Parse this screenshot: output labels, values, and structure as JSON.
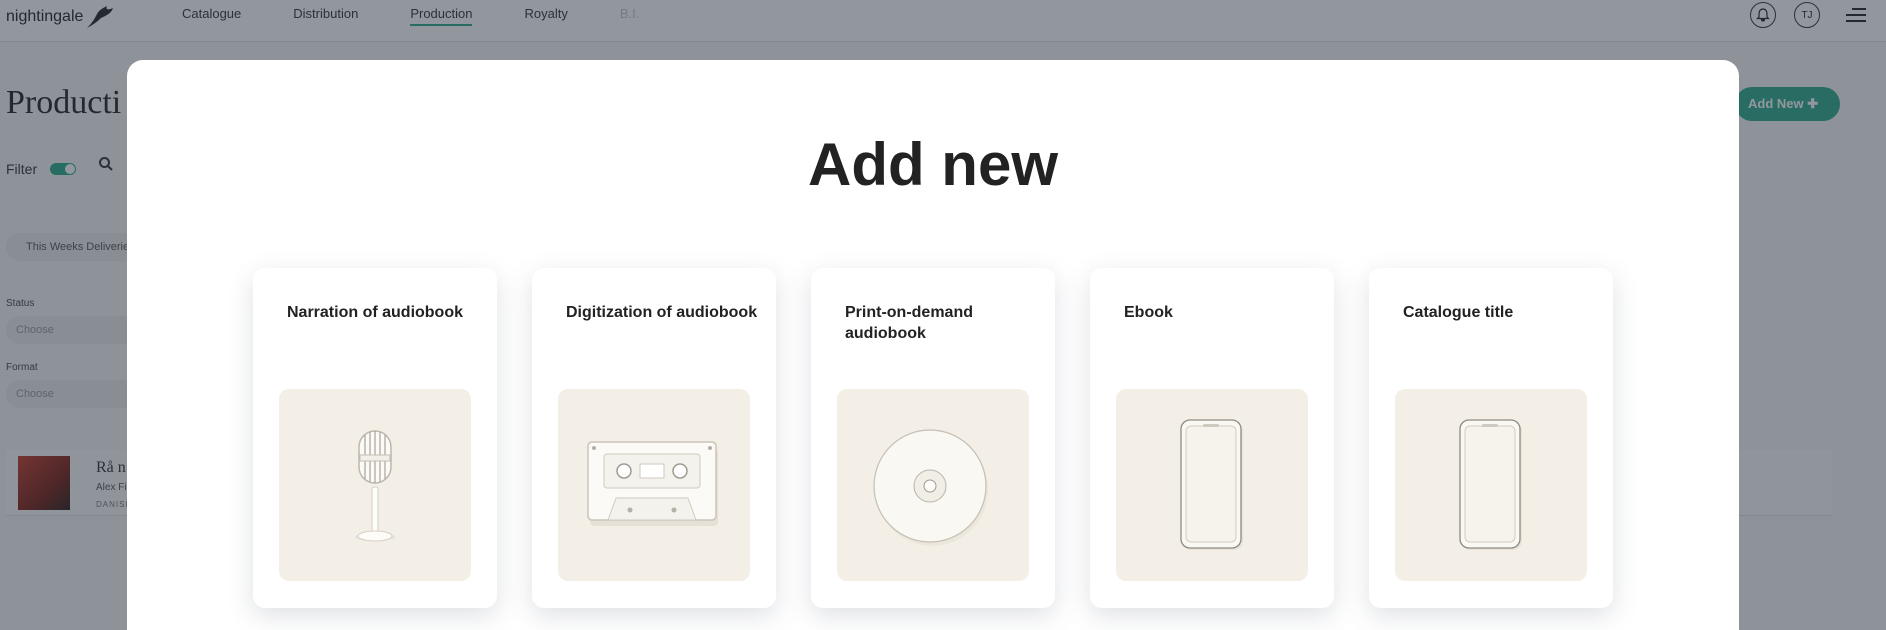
{
  "app": {
    "logo_text": "nightingale"
  },
  "nav": {
    "items": [
      "Catalogue",
      "Distribution",
      "Production",
      "Royalty",
      "B.I."
    ],
    "active": "Production"
  },
  "header": {
    "avatar_initials": "TJ"
  },
  "page": {
    "title": "Producti",
    "filter_label": "Filter",
    "quick_filter_chip": "This Weeks Deliveries",
    "status_label": "Status",
    "status_placeholder": "Choose",
    "format_label": "Format",
    "format_placeholder": "Choose",
    "add_new_label": "Add New"
  },
  "list_row": {
    "title": "Rå n",
    "subtitle": "Alex Fi",
    "language": "DANISH"
  },
  "modal": {
    "title": "Add new",
    "options": [
      {
        "label": "Narration of audiobook",
        "icon": "microphone-icon"
      },
      {
        "label": "Digitization of audiobook",
        "icon": "cassette-icon"
      },
      {
        "label": "Print-on-demand audiobook",
        "icon": "cd-icon"
      },
      {
        "label": "Ebook",
        "icon": "phone-icon"
      },
      {
        "label": "Catalogue title",
        "icon": "phone-icon"
      }
    ]
  },
  "colors": {
    "accent": "#2aa98a",
    "overlay": "#26303c",
    "card_image_bg": "#f3efe7"
  }
}
